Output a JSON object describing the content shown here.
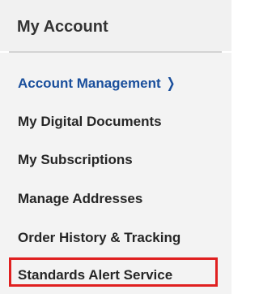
{
  "header": {
    "title": "My Account"
  },
  "nav": {
    "items": [
      {
        "label": "Account Management",
        "active": true,
        "icon": "chevron-right-icon"
      },
      {
        "label": "My Digital Documents",
        "active": false
      },
      {
        "label": "My Subscriptions",
        "active": false
      },
      {
        "label": "Manage Addresses",
        "active": false
      },
      {
        "label": "Order History & Tracking",
        "active": false
      },
      {
        "label": "Standards Alert Service",
        "active": false,
        "highlighted": true
      }
    ],
    "chevron_glyph": "❯"
  },
  "colors": {
    "active_link": "#1a4f9c",
    "highlight_border": "#e02020",
    "header_bg": "#f1f1f1",
    "body_bg": "#f3f3f3"
  }
}
